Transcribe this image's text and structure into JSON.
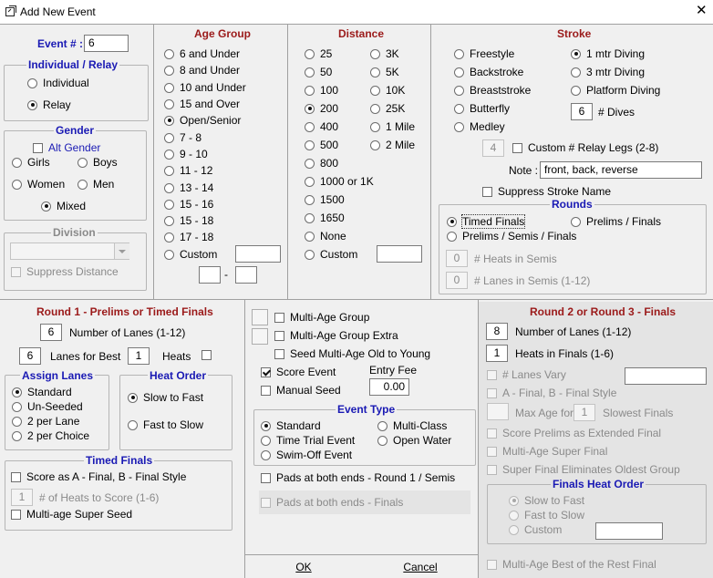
{
  "window": {
    "title": "Add New Event",
    "close_glyph": "✕"
  },
  "event_number": {
    "label": "Event # :",
    "value": "6"
  },
  "individual_relay": {
    "title": "Individual / Relay",
    "individual": "Individual",
    "relay": "Relay",
    "selected": "Relay"
  },
  "gender": {
    "title": "Gender",
    "alt_gender": "Alt Gender",
    "girls": "Girls",
    "boys": "Boys",
    "women": "Women",
    "men": "Men",
    "mixed": "Mixed",
    "selected": "Mixed"
  },
  "division": {
    "title": "Division",
    "value": "",
    "suppress": "Suppress Distance"
  },
  "age_group": {
    "title": "Age Group",
    "options": [
      "6 and Under",
      "8 and Under",
      "10 and Under",
      "15 and Over",
      "Open/Senior",
      "7 - 8",
      "9 - 10",
      "11 - 12",
      "13 - 14",
      "15 - 16",
      "15 - 18",
      "17 - 18",
      "Custom"
    ],
    "selected": "Open/Senior",
    "dash": "-"
  },
  "distance": {
    "title": "Distance",
    "col1": [
      "25",
      "50",
      "100",
      "200",
      "400",
      "500",
      "800",
      "1000 or 1K",
      "1500",
      "1650",
      "None",
      "Custom"
    ],
    "col2": [
      "3K",
      "5K",
      "10K",
      "25K",
      "1 Mile",
      "2 Mile"
    ],
    "selected": "200"
  },
  "stroke": {
    "title": "Stroke",
    "col1": [
      "Freestyle",
      "Backstroke",
      "Breaststroke",
      "Butterfly",
      "Medley"
    ],
    "col2": [
      "1 mtr Diving",
      "3 mtr Diving",
      "Platform Diving"
    ],
    "selected": "1 mtr Diving",
    "dives_value": "6",
    "dives_label": "# Dives",
    "relay_legs_value": "4",
    "relay_legs_label": "Custom # Relay Legs (2-8)",
    "note_label": "Note :",
    "note_value": "front, back, reverse",
    "suppress_stroke": "Suppress Stroke Name"
  },
  "rounds": {
    "title": "Rounds",
    "timed_finals": "Timed Finals",
    "prelims_finals": "Prelims / Finals",
    "prelims_semis_finals": "Prelims / Semis / Finals",
    "selected": "Timed Finals",
    "heats_semis_value": "0",
    "heats_semis_label": "# Heats in Semis",
    "lanes_semis_value": "0",
    "lanes_semis_label": "# Lanes in Semis (1-12)"
  },
  "round1": {
    "title": "Round 1 - Prelims or Timed Finals",
    "lanes_value": "6",
    "lanes_label": "Number of Lanes (1-12)",
    "best_value": "6",
    "best_label": "Lanes for Best",
    "heats_value": "1",
    "heats_label": "Heats"
  },
  "assign_lanes": {
    "title": "Assign Lanes",
    "options": [
      "Standard",
      "Un-Seeded",
      "2 per Lane",
      "2 per Choice"
    ],
    "selected": "Standard"
  },
  "heat_order": {
    "title": "Heat Order",
    "options": [
      "Slow to Fast",
      "Fast to Slow"
    ],
    "selected": "Slow to Fast"
  },
  "timed_finals": {
    "title": "Timed Finals",
    "score_ab": "Score as A - Final, B - Final Style",
    "heats_to_score_value": "1",
    "heats_to_score_label": "# of Heats to Score (1-6)",
    "multi_age_super_seed": "Multi-age Super Seed"
  },
  "middle": {
    "multi_age_group": "Multi-Age Group",
    "multi_age_group_extra": "Multi-Age Group Extra",
    "seed_multi_age": "Seed Multi-Age Old to Young",
    "score_event": "Score Event",
    "manual_seed": "Manual Seed",
    "entry_fee_label": "Entry Fee",
    "entry_fee_value": "0.00",
    "pads_round1": "Pads at both ends - Round 1 / Semis",
    "pads_finals": "Pads at both ends - Finals"
  },
  "event_type": {
    "title": "Event Type",
    "standard": "Standard",
    "multi_class": "Multi-Class",
    "time_trial": "Time Trial Event",
    "open_water": "Open Water",
    "swim_off": "Swim-Off Event",
    "selected": "Standard"
  },
  "buttons": {
    "ok": "OK",
    "cancel": "Cancel"
  },
  "round23": {
    "title": "Round 2 or Round 3 - Finals",
    "lanes_value": "8",
    "lanes_label": "Number of Lanes (1-12)",
    "heats_value": "1",
    "heats_label": "Heats in Finals (1-6)",
    "lanes_vary": "# Lanes Vary",
    "ab_final": "A - Final, B - Final Style",
    "max_age_label": "Max Age for",
    "max_age_value": "1",
    "slowest_finals": "Slowest Finals",
    "score_prelims": "Score Prelims as Extended Final",
    "multi_age_super_final": "Multi-Age Super Final",
    "super_final_oldest": "Super Final Eliminates Oldest Group",
    "best_of_rest": "Multi-Age Best of the Rest Final"
  },
  "finals_heat_order": {
    "title": "Finals Heat Order",
    "options": [
      "Slow to Fast",
      "Fast to Slow",
      "Custom"
    ],
    "selected": "Slow to Fast"
  }
}
